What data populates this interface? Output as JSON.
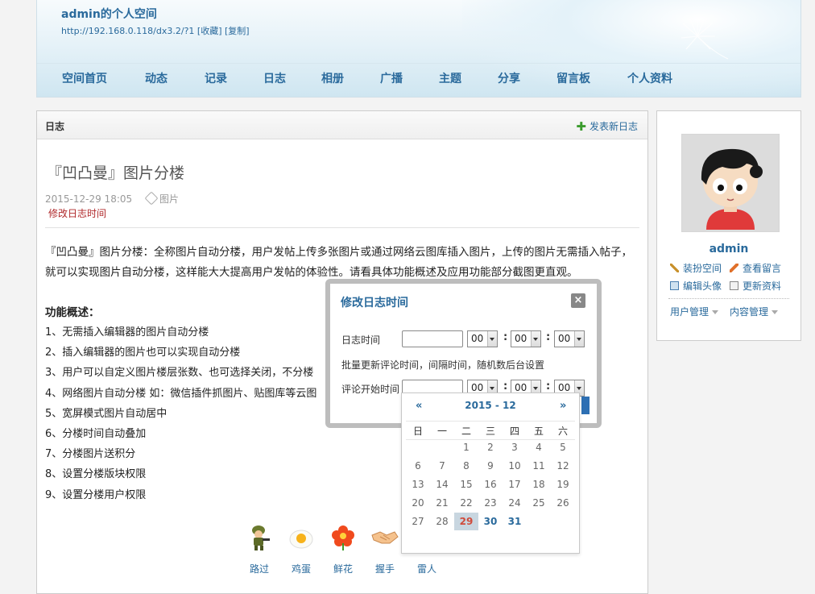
{
  "header": {
    "title": "admin的个人空间",
    "url": "http://192.168.0.118/dx3.2/?1",
    "fav_label": "[收藏]",
    "copy_label": "[复制]"
  },
  "nav": [
    {
      "label": "空间首页"
    },
    {
      "label": "动态"
    },
    {
      "label": "记录"
    },
    {
      "label": "日志"
    },
    {
      "label": "相册"
    },
    {
      "label": "广播"
    },
    {
      "label": "主题"
    },
    {
      "label": "分享"
    },
    {
      "label": "留言板"
    },
    {
      "label": "个人资料"
    }
  ],
  "main": {
    "section_label": "日志",
    "post_new_label": "发表新日志",
    "blog_title": "『凹凸曼』图片分楼",
    "date": "2015-12-29 18:05",
    "tag": "图片",
    "edit_time_link": "修改日志时间",
    "intro": "『凹凸曼』图片分楼：全称图片自动分楼，用户发帖上传多张图片或通过网络云图库插入图片，上传的图片无需插入帖子，就可以实现图片自动分楼，这样能大大提高用户发帖的体验性。请看具体功能概述及应用功能部分截图更直观。",
    "features_title": "功能概述：",
    "features": [
      "1、无需插入编辑器的图片自动分楼",
      "2、插入编辑器的图片也可以实现自动分楼",
      "3、用户可以自定义图片楼层张数、也可选择关闭，不分楼",
      "4、网络图片自动分楼 如：微信插件抓图片、贴图库等云图",
      "5、宽屏模式图片自动居中",
      "6、分楼时间自动叠加",
      "7、分楼图片送积分",
      "8、设置分楼版块权限",
      "9、设置分楼用户权限"
    ],
    "reactions": [
      {
        "label": "路过",
        "icon": "soldier-icon"
      },
      {
        "label": "鸡蛋",
        "icon": "egg-icon"
      },
      {
        "label": "鲜花",
        "icon": "flower-icon"
      },
      {
        "label": "握手",
        "icon": "handshake-icon"
      },
      {
        "label": "雷人",
        "icon": "shock-icon"
      }
    ]
  },
  "sidebar": {
    "username": "admin",
    "links": [
      {
        "label": "装扮空间",
        "icon": "wrench-icon"
      },
      {
        "label": "查看留言",
        "icon": "pencil-icon"
      },
      {
        "label": "编辑头像",
        "icon": "avatar-icon"
      },
      {
        "label": "更新资料",
        "icon": "profile-card-icon"
      }
    ],
    "menus": [
      {
        "label": "用户管理"
      },
      {
        "label": "内容管理"
      }
    ]
  },
  "dialog": {
    "title": "修改日志时间",
    "close_label": "×",
    "blog_time_label": "日志时间",
    "batch_note": "批量更新评论时间，间隔时间，随机数后台设置",
    "comment_start_label": "评论开始时间",
    "hour": "00",
    "minute": "00",
    "second": "00"
  },
  "calendar": {
    "prev": "«",
    "next": "»",
    "month_label": "2015 - 12",
    "weekdays": [
      "日",
      "一",
      "二",
      "三",
      "四",
      "五",
      "六"
    ],
    "first_weekday": 2,
    "days_in_month": 31,
    "today": 29
  },
  "colors": {
    "link": "#2a6a9c",
    "accent_red": "#b0292b"
  }
}
